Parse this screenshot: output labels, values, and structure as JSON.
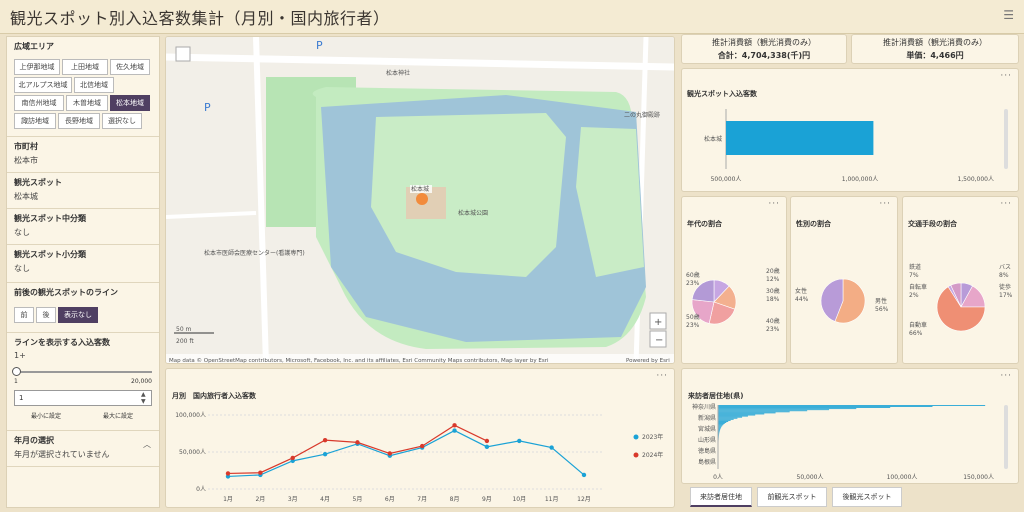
{
  "header": {
    "title": "観光スポット別入込客数集計（月別・国内旅行者）"
  },
  "sidebar": {
    "area_label": "広域エリア",
    "areas": [
      "上伊那地域",
      "上田地域",
      "佐久地域",
      "北アルプス地域",
      "北信地域",
      "南信州地域",
      "木曽地域",
      "松本地域",
      "諏訪地域",
      "長野地域",
      "選択なし"
    ],
    "city_label": "市町村",
    "city_value": "松本市",
    "spot_label": "観光スポット",
    "spot_value": "松本城",
    "mid_label": "観光スポット中分類",
    "mid_value": "なし",
    "small_label": "観光スポット小分類",
    "small_value": "なし",
    "line_label": "前後の観光スポットのライン",
    "line_opts": [
      "前",
      "後",
      "表示なし"
    ],
    "threshold_label": "ラインを表示する入込客数",
    "threshold_min_text": "1+",
    "slider_min": "1",
    "slider_max": "20,000",
    "input_value": "1",
    "min_set": "最小に設定",
    "max_set": "最大に設定",
    "ym_label": "年月の選択",
    "ym_value": "年月が選択されていません"
  },
  "map": {
    "attrib": "Map data © OpenStreetMap contributors, Microsoft, Facebook, Inc. and its affiliates, Esri Community Maps contributors, Map layer by Esri",
    "powered": "Powered by Esri",
    "scale_m": "50 m",
    "scale_ft": "200 ft",
    "labels": {
      "castle": "松本城",
      "park": "松本城公園",
      "hosp": "松本市医師会医療センター(看護専門)",
      "jinja": "松本神社",
      "gate": "二の丸御殿跡"
    }
  },
  "kpi": {
    "title1": "推計消費額（観光消費のみ）",
    "value1": "合計：4,704,338(千)円",
    "title2": "推計消費額（観光消費のみ）",
    "value2": "単価：4,466円"
  },
  "bar_title": "観光スポット入込客数",
  "age_title": "年代の割合",
  "gender_title": "性別の割合",
  "trans_title": "交通手段の割合",
  "line_title": "月別　国内旅行者入込客数",
  "res_title": "来訪者居住地(県)",
  "tabs": [
    "来訪者居住地",
    "前観光スポット",
    "後観光スポット"
  ],
  "chart_data": [
    {
      "type": "bar",
      "title": "観光スポット入込客数",
      "categories": [
        "松本城"
      ],
      "values": [
        1050000
      ],
      "xlim": [
        500000,
        1500000
      ],
      "ticks": [
        "500,000人",
        "1,000,000人",
        "1,500,000人"
      ],
      "color": "#1aa2d6"
    },
    {
      "type": "pie",
      "title": "年代の割合",
      "labels": [
        "20歳",
        "30歳",
        "40歳",
        "50歳",
        "60歳"
      ],
      "values": [
        12,
        18,
        23,
        23,
        23
      ],
      "colors": [
        "#c6a6e2",
        "#f3b08f",
        "#f0a0a0",
        "#e7a6c9",
        "#b39ad6"
      ]
    },
    {
      "type": "pie",
      "title": "性別の割合",
      "labels": [
        "男性",
        "女性"
      ],
      "values": [
        56,
        44
      ],
      "colors": [
        "#f3ad85",
        "#b89bd8"
      ]
    },
    {
      "type": "pie",
      "title": "交通手段の割合",
      "labels": [
        "バス",
        "徒歩",
        "自動車",
        "自転車",
        "鉄道"
      ],
      "values": [
        8,
        17,
        66,
        2,
        7
      ],
      "colors": [
        "#b89bd8",
        "#e7a6c9",
        "#ef8f74",
        "#c6a6e2",
        "#d49bc7"
      ]
    },
    {
      "type": "line",
      "title": "月別　国内旅行者入込客数",
      "categories": [
        "1月",
        "2月",
        "3月",
        "4月",
        "5月",
        "6月",
        "7月",
        "8月",
        "9月",
        "10月",
        "11月",
        "12月"
      ],
      "ylim": [
        0,
        100000
      ],
      "yticks": [
        "0人",
        "50,000人",
        "100,000人"
      ],
      "series": [
        {
          "name": "2023年",
          "color": "#1aa2d6",
          "values": [
            17000,
            19000,
            38000,
            47000,
            61000,
            45000,
            56000,
            79000,
            57000,
            65000,
            56000,
            19000
          ]
        },
        {
          "name": "2024年",
          "color": "#d8392b",
          "values": [
            21000,
            22000,
            42000,
            66000,
            63000,
            48000,
            58000,
            86000,
            65000,
            null,
            null,
            null
          ]
        }
      ]
    },
    {
      "type": "bar",
      "title": "来訪者居住地(県)",
      "categories": [
        "神奈川県",
        "新潟県",
        "宮城県",
        "山形県",
        "徳島県",
        "島根県"
      ],
      "xticks": [
        "0人",
        "50,000人",
        "100,000人",
        "150,000人"
      ],
      "xlim": [
        0,
        150000
      ],
      "values": [
        145000,
        6000,
        3000,
        1500,
        800,
        300
      ],
      "color": "#1aa2d6"
    }
  ]
}
